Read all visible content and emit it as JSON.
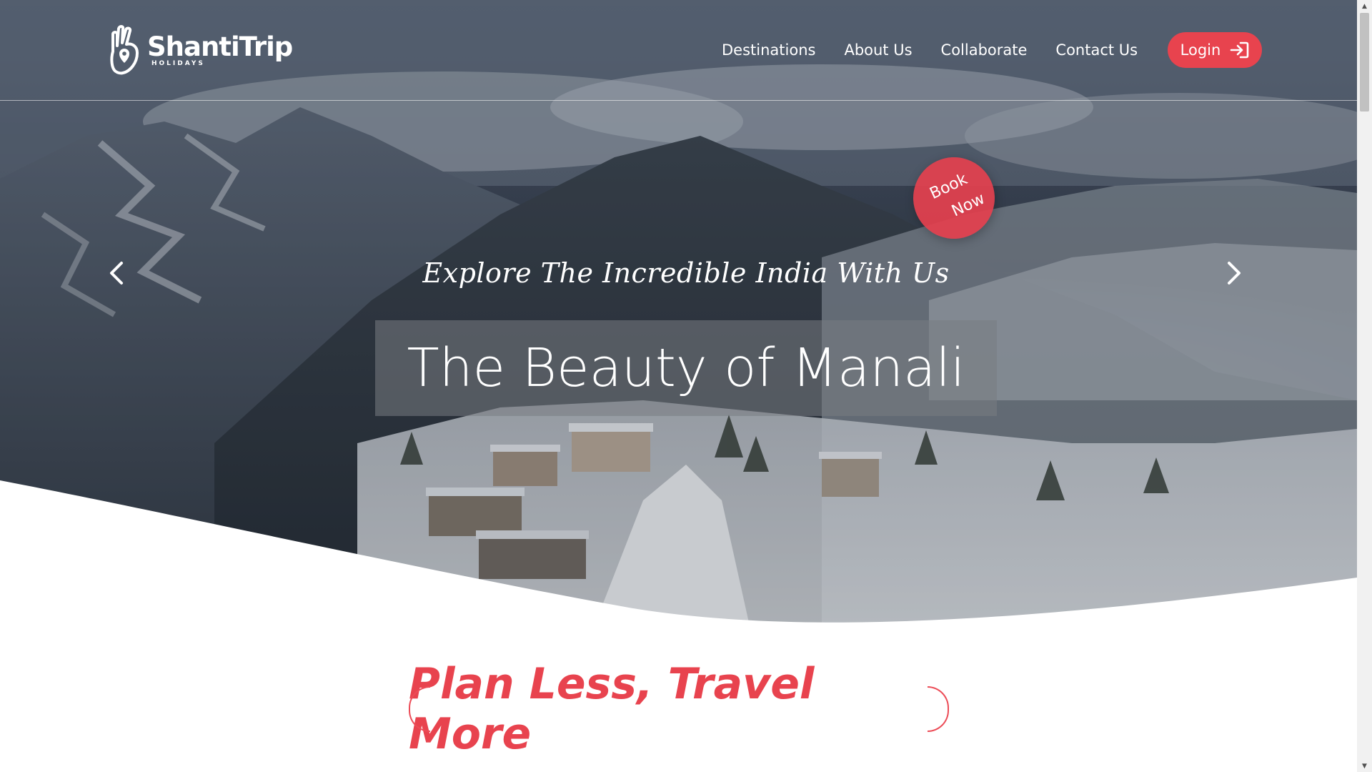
{
  "brand": {
    "name": "ShantiTrip",
    "sub": "HOLIDAYS"
  },
  "nav": [
    {
      "label": "Destinations"
    },
    {
      "label": "About Us"
    },
    {
      "label": "Collaborate"
    },
    {
      "label": "Contact Us"
    }
  ],
  "login": {
    "label": "Login"
  },
  "hero": {
    "tagline": "Explore The Incredible India With Us",
    "title": "The Beauty of Manali",
    "book_now": [
      "Book",
      "Now"
    ]
  },
  "section": {
    "heading": "Plan Less, Travel More"
  },
  "colors": {
    "accent": "#e8434e",
    "white": "#ffffff"
  },
  "icons": {
    "logo": "hand-ok-pin-icon",
    "login": "sign-in-arrow-icon",
    "prev": "chevron-left-icon",
    "next": "chevron-right-icon"
  }
}
